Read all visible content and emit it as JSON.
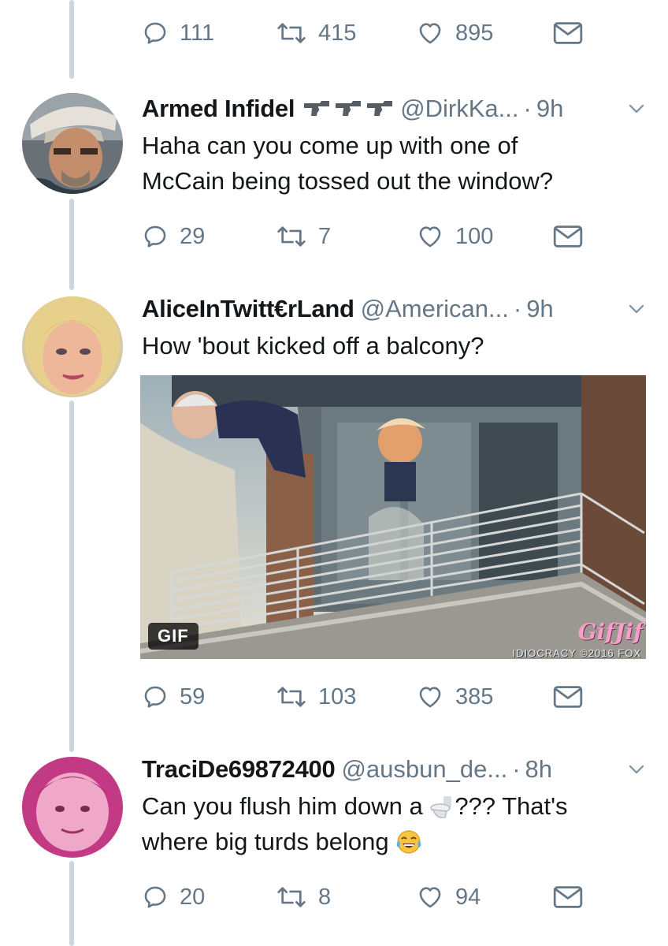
{
  "top_actions": {
    "replies": "111",
    "retweets": "415",
    "likes": "895"
  },
  "tweets": [
    {
      "name": "Armed Infidel",
      "name_emoji": "revolver-emoji",
      "handle": "@DirkKa...",
      "time": "9h",
      "text_lines": [
        "Haha can you come up with one of",
        "McCain being tossed out the window?"
      ],
      "actions": {
        "replies": "29",
        "retweets": "7",
        "likes": "100"
      }
    },
    {
      "name": "AliceInTwitt€rLand",
      "handle": "@American...",
      "time": "9h",
      "text_lines": [
        "How 'bout kicked off a balcony?"
      ],
      "media": {
        "badge": "GIF",
        "watermark": "GifJif",
        "caption": "IDIOCRACY ©2016 FOX"
      },
      "actions": {
        "replies": "59",
        "retweets": "103",
        "likes": "385"
      }
    },
    {
      "name": "TraciDe69872400",
      "handle": "@ausbun_de...",
      "time": "8h",
      "text_line1_before": "Can you flush him down a ",
      "text_line1_after": "??? That's",
      "text_line2": "where big turds belong ",
      "emojis": [
        "toilet-emoji",
        "tears-of-joy-emoji"
      ],
      "actions": {
        "replies": "20",
        "retweets": "8",
        "likes": "94"
      }
    }
  ],
  "colors": {
    "text": "#14171a",
    "secondary": "#657786",
    "thread_line": "#ccd6dd"
  }
}
